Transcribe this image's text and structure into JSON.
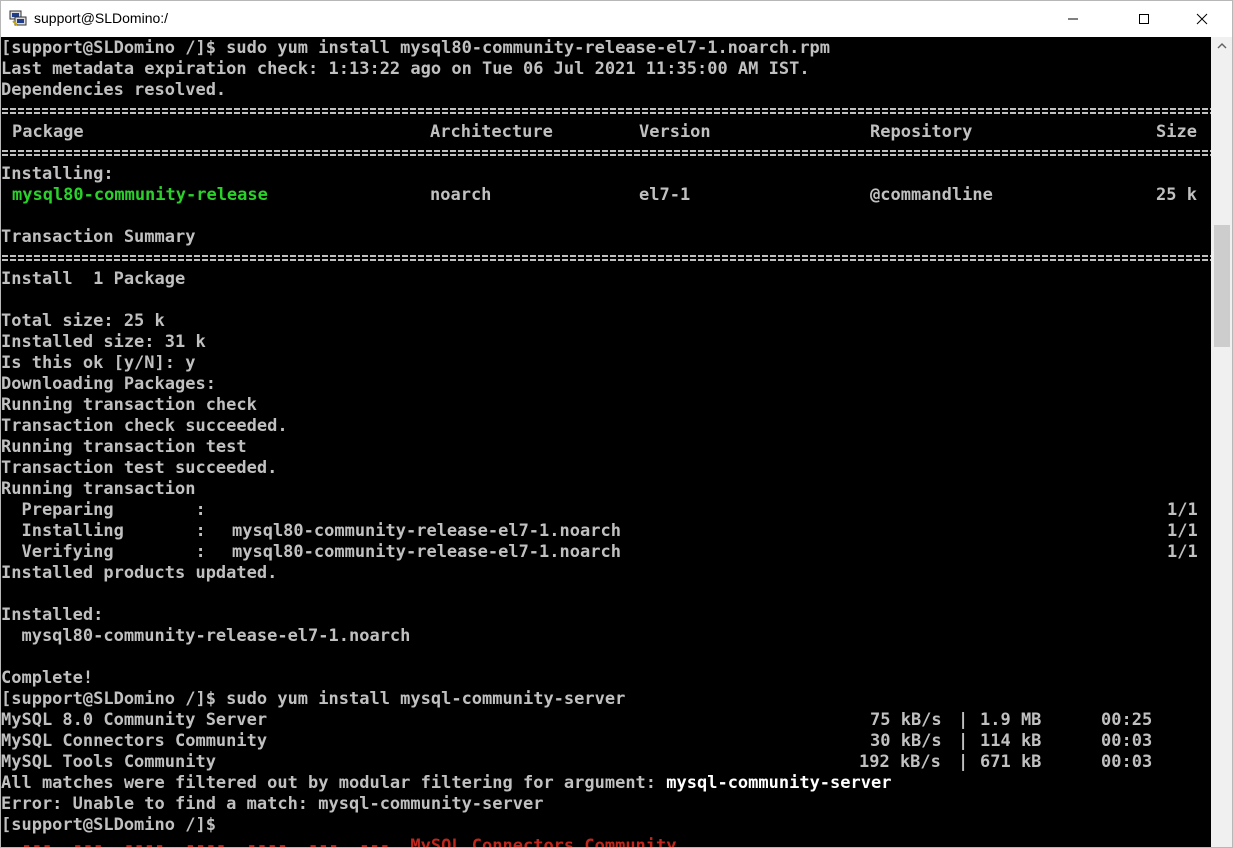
{
  "window": {
    "title": "support@SLDomino:/",
    "icon": "putty-icon"
  },
  "terminal": {
    "cmd1": "[support@SLDomino /]$ sudo yum install mysql80-community-release-el7-1.noarch.rpm",
    "metadata": "Last metadata expiration check: 1:13:22 ago on Tue 06 Jul 2021 11:35:00 AM IST.",
    "deps": "Dependencies resolved.",
    "table": {
      "headers": [
        "Package",
        "Architecture",
        "Version",
        "Repository",
        "Size"
      ],
      "section": "Installing:",
      "row": [
        "mysql80-community-release",
        "noarch",
        "el7-1",
        "@commandline",
        "25 k"
      ]
    },
    "summary_title": "Transaction Summary",
    "install_count": "Install  1 Package",
    "total_size": "Total size: 25 k",
    "installed_size": "Installed size: 31 k",
    "confirm": "Is this ok [y/N]: y",
    "downloading": "Downloading Packages:",
    "run_check": "Running transaction check",
    "check_ok": "Transaction check succeeded.",
    "run_test": "Running transaction test",
    "test_ok": "Transaction test succeeded.",
    "run_tx": "Running transaction",
    "steps": [
      {
        "label": "  Preparing        :",
        "pkg": "",
        "count": "1/1"
      },
      {
        "label": "  Installing       :",
        "pkg": "mysql80-community-release-el7-1.noarch",
        "count": "1/1"
      },
      {
        "label": "  Verifying        :",
        "pkg": "mysql80-community-release-el7-1.noarch",
        "count": "1/1"
      }
    ],
    "products_updated": "Installed products updated.",
    "installed_label": "Installed:",
    "installed_pkg": "  mysql80-community-release-el7-1.noarch",
    "complete": "Complete!",
    "cmd2": "[support@SLDomino /]$ sudo yum install mysql-community-server",
    "repos": [
      {
        "name": "MySQL 8.0 Community Server",
        "speed": "75 kB/s",
        "size": "1.9 MB",
        "time": "00:25"
      },
      {
        "name": "MySQL Connectors Community",
        "speed": "30 kB/s",
        "size": "114 kB",
        "time": "00:03"
      },
      {
        "name": "MySQL Tools Community",
        "speed": "192 kB/s",
        "size": "671 kB",
        "time": "00:03"
      }
    ],
    "filtered_prefix": "All matches were filtered out by modular filtering for argument: ",
    "filtered_arg": "mysql-community-server",
    "error": "Error: Unable to find a match: mysql-community-server",
    "prompt": "[support@SLDomino /]$",
    "partial_line": "  ---  ---  ----  ----  ----  ---  ---  MySQL Connectors Community"
  },
  "colors": {
    "text": "#c0c0c0",
    "highlight": "#2bd12b",
    "bold_white": "#ffffff",
    "background": "#000000"
  }
}
